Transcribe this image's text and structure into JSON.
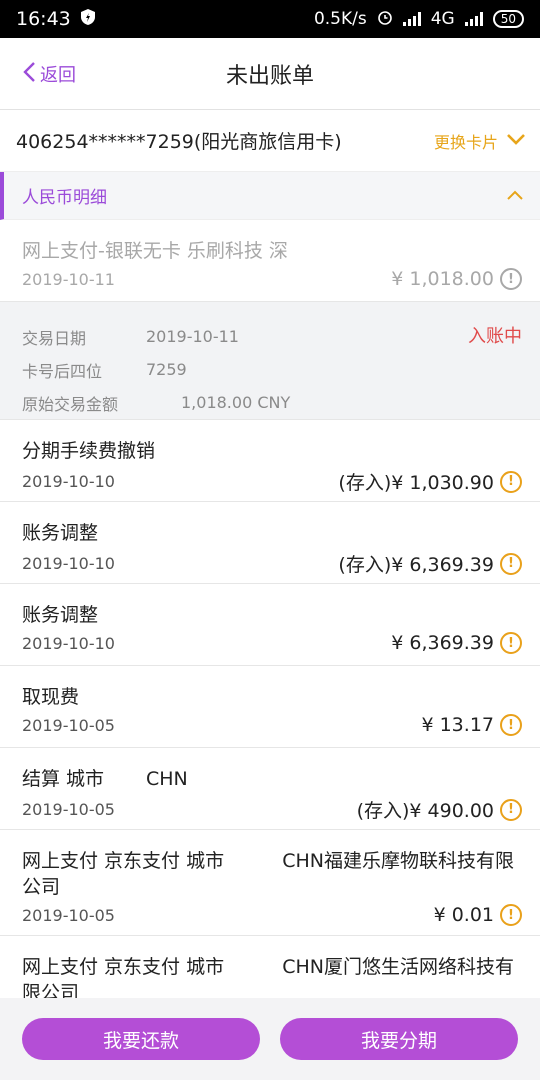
{
  "status_bar": {
    "time": "16:43",
    "speed": "0.5K/s",
    "network": "4G",
    "battery": "50"
  },
  "nav": {
    "back_label": "返回",
    "title": "未出账单"
  },
  "card": {
    "number_label": "406254******7259(阳光商旅信用卡)",
    "change_label": "更换卡片"
  },
  "section": {
    "title": "人民币明细"
  },
  "transactions": [
    {
      "desc": "网上支付-银联无卡 乐刷科技 深",
      "date": "2019-10-11",
      "amount": "¥ 1,018.00"
    },
    {
      "desc": "分期手续费撤销",
      "date": "2019-10-10",
      "amount": "(存入)¥  1,030.90"
    },
    {
      "desc": "账务调整",
      "date": "2019-10-10",
      "amount": "(存入)¥  6,369.39"
    },
    {
      "desc": "账务调整",
      "date": "2019-10-10",
      "amount": "¥  6,369.39"
    },
    {
      "desc": "取现费",
      "date": "2019-10-05",
      "amount": "¥  13.17"
    },
    {
      "desc_left": "结算 城市",
      "desc_right": "CHN",
      "date": "2019-10-05",
      "amount": "(存入)¥  490.00"
    },
    {
      "desc_left": "网上支付 京东支付 城市",
      "desc_right": "CHN福建乐摩物联科技有限",
      "desc_line2": "公司",
      "date": "2019-10-05",
      "amount": "¥  0.01"
    },
    {
      "desc_left": "网上支付 京东支付 城市",
      "desc_right": "CHN厦门悠生活网络科技有",
      "desc_line2": "限公司"
    }
  ],
  "detail": {
    "date_key": "交易日期",
    "date_val": "2019-10-11",
    "card_key": "卡号后四位",
    "card_val": "7259",
    "orig_key": "原始交易金额",
    "orig_val": "1,018.00 CNY",
    "status": "入账中"
  },
  "buttons": {
    "repay": "我要还款",
    "installment": "我要分期"
  },
  "colors": {
    "accent": "#9b4bd9",
    "button": "#b44ed6",
    "warn": "#e9a11b",
    "status_red": "#e04b4b"
  }
}
